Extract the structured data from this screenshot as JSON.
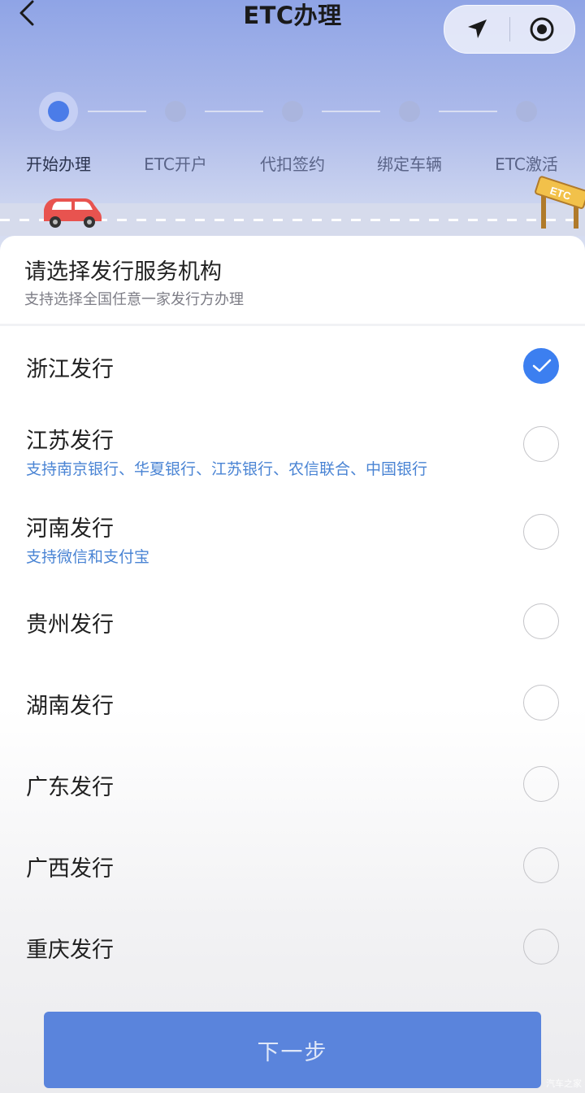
{
  "header": {
    "title": "ETC办理"
  },
  "steps": [
    {
      "label": "开始办理",
      "active": true
    },
    {
      "label": "ETC开户",
      "active": false
    },
    {
      "label": "代扣签约",
      "active": false
    },
    {
      "label": "绑定车辆",
      "active": false
    },
    {
      "label": "ETC激活",
      "active": false
    }
  ],
  "gate_sign": "ETC",
  "sheet": {
    "title": "请选择发行服务机构",
    "subtitle": "支持选择全国任意一家发行方办理"
  },
  "issuers": [
    {
      "name": "浙江发行",
      "desc": "",
      "selected": true
    },
    {
      "name": "江苏发行",
      "desc": "支持南京银行、华夏银行、江苏银行、农信联合、中国银行",
      "selected": false
    },
    {
      "name": "河南发行",
      "desc": "支持微信和支付宝",
      "selected": false
    },
    {
      "name": "贵州发行",
      "desc": "",
      "selected": false
    },
    {
      "name": "湖南发行",
      "desc": "",
      "selected": false
    },
    {
      "name": "广东发行",
      "desc": "",
      "selected": false
    },
    {
      "name": "广西发行",
      "desc": "",
      "selected": false
    },
    {
      "name": "重庆发行",
      "desc": "",
      "selected": false
    }
  ],
  "footer": {
    "next_label": "下一步"
  },
  "watermark": "汽车之家",
  "colors": {
    "accent": "#3c7ff0",
    "link": "#4a84d4",
    "button": "#5a84dc"
  }
}
